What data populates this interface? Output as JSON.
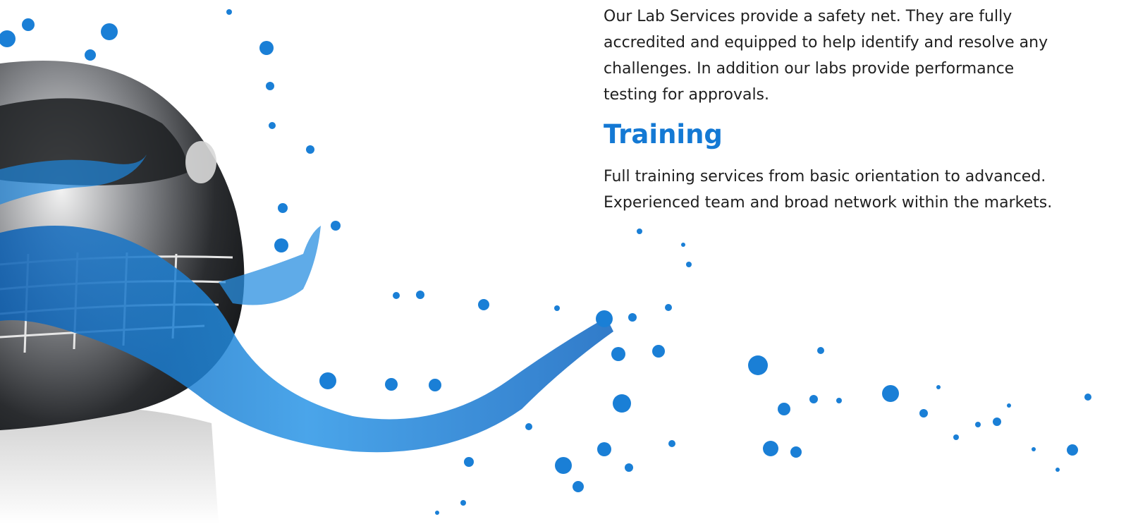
{
  "hero": {
    "image_description": "car-water-splash-image"
  },
  "lab_services": {
    "lines": [
      "Our Lab Services provide a safety net.  They are fully",
      "accredited and equipped to help identify and resolve any",
      "challenges.  In addition our labs provide performance",
      "testing for approvals."
    ]
  },
  "training": {
    "heading": "Training",
    "lines": [
      "Full training services from basic orientation to advanced.",
      "Experienced team and broad network within the markets."
    ]
  },
  "colors": {
    "heading": "#1479d4",
    "text": "#1f1f1f",
    "water": "#1a7fd6",
    "car_body": "#2a2c2f"
  }
}
